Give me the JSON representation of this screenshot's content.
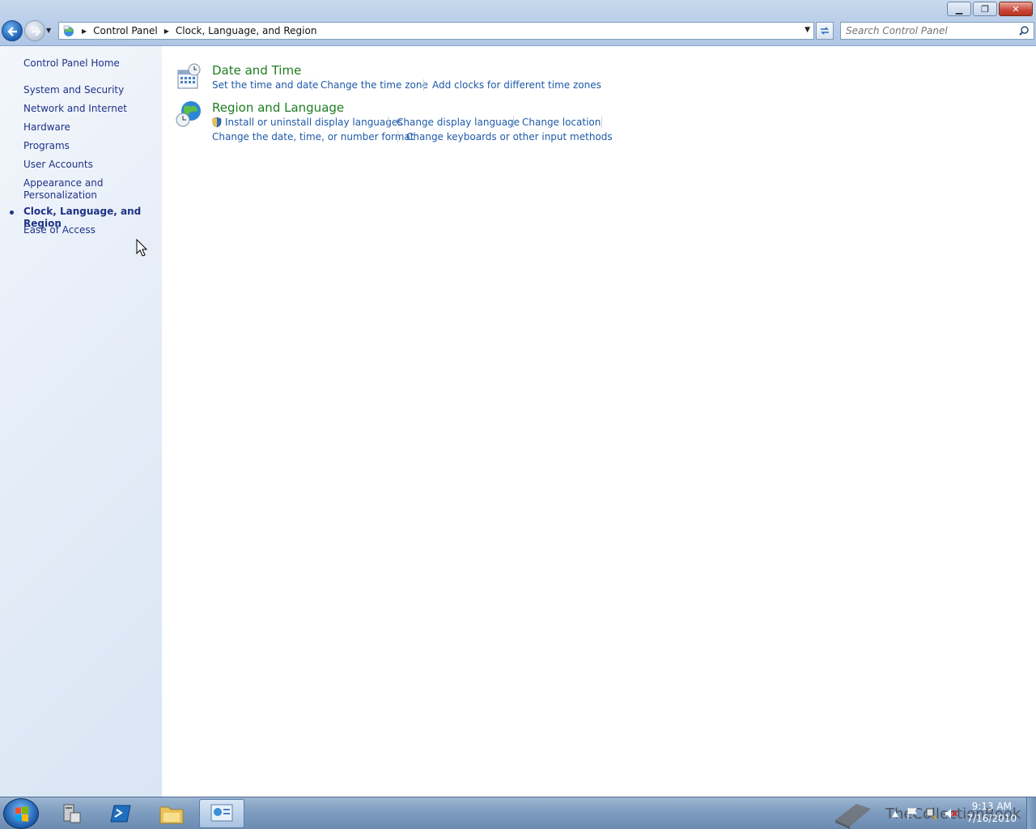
{
  "window": {
    "controls": {
      "minimize": "▁",
      "maximize": "❐",
      "close": "✕"
    }
  },
  "address_bar": {
    "crumbs": [
      "Control Panel",
      "Clock, Language, and Region"
    ]
  },
  "search": {
    "placeholder": "Search Control Panel"
  },
  "sidebar": {
    "home": "Control Panel Home",
    "items": [
      {
        "label": "System and Security",
        "active": false
      },
      {
        "label": "Network and Internet",
        "active": false
      },
      {
        "label": "Hardware",
        "active": false
      },
      {
        "label": "Programs",
        "active": false
      },
      {
        "label": "User Accounts",
        "active": false
      },
      {
        "label": "Appearance and Personalization",
        "active": false
      },
      {
        "label": "Clock, Language, and Region",
        "active": true
      },
      {
        "label": "Ease of Access",
        "active": false
      }
    ]
  },
  "categories": [
    {
      "title": "Date and Time",
      "links": [
        "Set the time and date",
        "Change the time zone",
        "Add clocks for different time zones"
      ]
    },
    {
      "title": "Region and Language",
      "links": [
        "Install or uninstall display languages",
        "Change display language",
        "Change location",
        "Change the date, time, or number format",
        "Change keyboards or other input methods"
      ]
    }
  ],
  "taskbar": {
    "watermark": "TheCollectionBook",
    "clock_time": "9:13 AM",
    "clock_date": "7/16/2010"
  },
  "colors": {
    "link": "#1e5aa8",
    "category_title": "#1e7d22",
    "sidebar_text": "#1e3287"
  }
}
